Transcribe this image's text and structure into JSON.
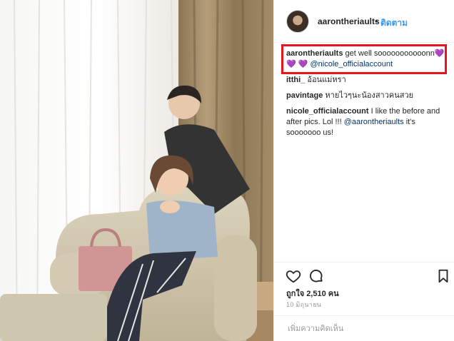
{
  "post": {
    "username": "aarontheriaults",
    "separator": "•",
    "follow_label": "ติดตาม"
  },
  "comments": [
    {
      "user": "aarontheriaults",
      "text": "get well sooooooooooonn",
      "hearts_inline": "💜",
      "hearts_line2": "💜 💜",
      "mention": "@nicole_officialaccount",
      "highlighted": true
    },
    {
      "user": "itthi_",
      "text": "อ้อนแม่หรา"
    },
    {
      "user": "pavintage",
      "text": "หายไวๆนะน้องสาวคนสวย"
    },
    {
      "user": "nicole_officialaccount",
      "text": "I like the before and after pics. Lol !!!",
      "mention": "@aarontheriaults",
      "text_after": "it's sooooooo us!"
    }
  ],
  "actions": {
    "like_icon": "heart-icon",
    "comment_icon": "comment-bubble-icon",
    "save_icon": "bookmark-icon"
  },
  "likes_text": "ถูกใจ 2,510 คน",
  "date_text": "10 มิถุนายน",
  "add_comment_placeholder": "เพิ่มความคิดเห็น",
  "colors": {
    "follow": "#3897f0",
    "mention": "#003569",
    "highlight_box": "#e8141c",
    "heart_emoji": "#7a53c8"
  }
}
